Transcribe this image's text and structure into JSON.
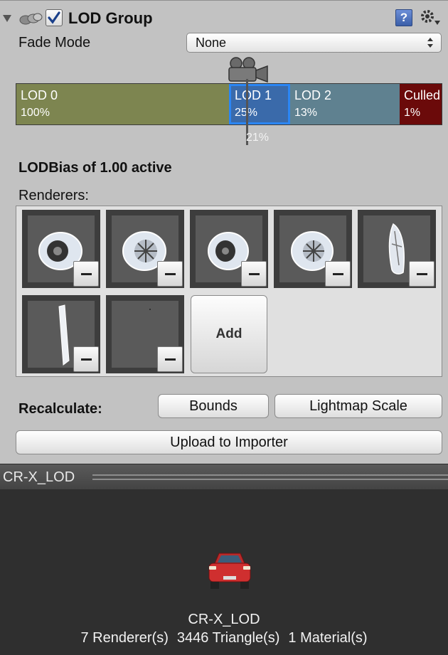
{
  "component": {
    "title": "LOD Group",
    "enabled": true
  },
  "fade_mode": {
    "label": "Fade Mode",
    "value": "None"
  },
  "lod_levels": [
    {
      "name": "LOD 0",
      "percent": "100%",
      "color": "#7d8550"
    },
    {
      "name": "LOD 1",
      "percent": "25%",
      "color": "#3a6aaa",
      "selected": true
    },
    {
      "name": "LOD 2",
      "percent": "13%",
      "color": "#5f8190"
    },
    {
      "name": "Culled",
      "percent": "1%",
      "color": "#6b0a0a"
    }
  ],
  "camera_percent": "21%",
  "lod_bias": "LODBias of 1.00 active",
  "renderers": {
    "label": "Renderers:",
    "items": [
      "wheel",
      "wheel",
      "wheel",
      "wheel",
      "body-panel",
      "door-panel",
      "empty"
    ],
    "add_label": "Add"
  },
  "recalculate": {
    "label": "Recalculate:",
    "bounds_label": "Bounds",
    "lightmap_label": "Lightmap Scale"
  },
  "upload_label": "Upload to Importer",
  "preview": {
    "title": "CR-X_LOD",
    "object_name": "CR-X_LOD",
    "renderers": "7 Renderer(s)",
    "triangles": "3446 Triangle(s)",
    "materials": "1 Material(s)"
  },
  "colors": {
    "selection_border": "#2b86f4",
    "panel_bg": "#c2c2c2",
    "preview_bg": "#2f2f2f"
  }
}
